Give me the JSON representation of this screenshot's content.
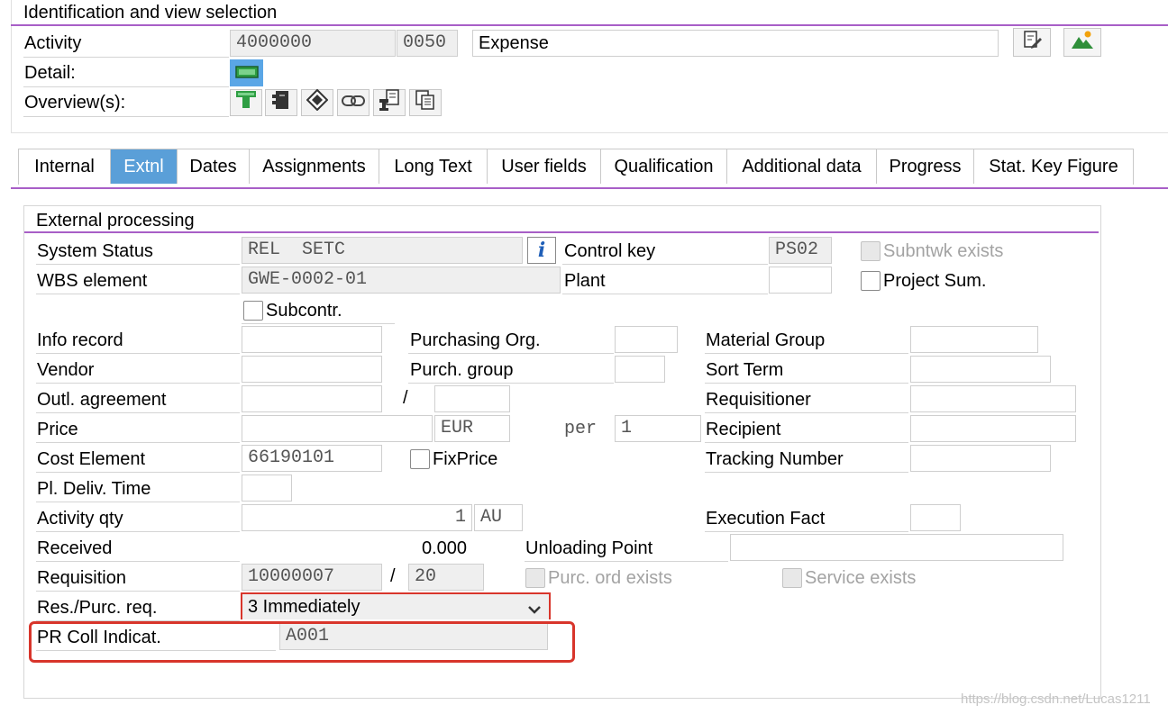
{
  "header": {
    "section_title": "Identification and view selection",
    "activity_label": "Activity",
    "activity_network": "4000000",
    "activity_number": "0050",
    "activity_desc": "Expense",
    "detail_label": "Detail:",
    "overview_label": "Overview(s):"
  },
  "tabs": [
    "Internal",
    "Extnl",
    "Dates",
    "Assignments",
    "Long Text",
    "User fields",
    "Qualification",
    "Additional data",
    "Progress",
    "Stat. Key Figure"
  ],
  "form": {
    "group_title": "External processing",
    "system_status_label": "System Status",
    "system_status_value": "REL  SETC",
    "control_key_label": "Control key",
    "control_key_value": "PS02",
    "subntwk_label": "Subntwk exists",
    "wbs_label": "WBS element",
    "wbs_value": "GWE-0002-01",
    "plant_label": "Plant",
    "project_sum_label": "Project Sum.",
    "subcontr_label": "Subcontr.",
    "info_record_label": "Info record",
    "purch_org_label": "Purchasing Org.",
    "material_group_label": "Material Group",
    "vendor_label": "Vendor",
    "purch_group_label": "Purch. group",
    "sort_term_label": "Sort Term",
    "outl_agreement_label": "Outl. agreement",
    "slash": "/",
    "requisitioner_label": "Requisitioner",
    "price_label": "Price",
    "currency_value": "EUR",
    "per_label": "per",
    "per_value": "1",
    "recipient_label": "Recipient",
    "cost_element_label": "Cost Element",
    "cost_element_value": "66190101",
    "fixprice_label": "FixPrice",
    "tracking_label": "Tracking Number",
    "deliv_time_label": "Pl. Deliv. Time",
    "activity_qty_label": "Activity qty",
    "activity_qty_value": "1",
    "activity_qty_unit": "AU",
    "execution_fact_label": "Execution Fact",
    "received_label": "Received",
    "received_value": "0.000",
    "unloading_point_label": "Unloading Point",
    "requisition_label": "Requisition",
    "requisition_value": "10000007",
    "requisition_item": "20",
    "purc_ord_label": "Purc. ord exists",
    "service_exists_label": "Service exists",
    "res_purc_label": "Res./Purc. req.",
    "res_purc_value": "3 Immediately",
    "pr_coll_label": "PR Coll Indicat.",
    "pr_coll_value": "A001"
  },
  "watermark": "https://blog.csdn.net/Lucas1211",
  "colors": {
    "accent_purple": "#a85fc7",
    "tab_active": "#5a9fd8",
    "highlight_red": "#d8352b"
  }
}
